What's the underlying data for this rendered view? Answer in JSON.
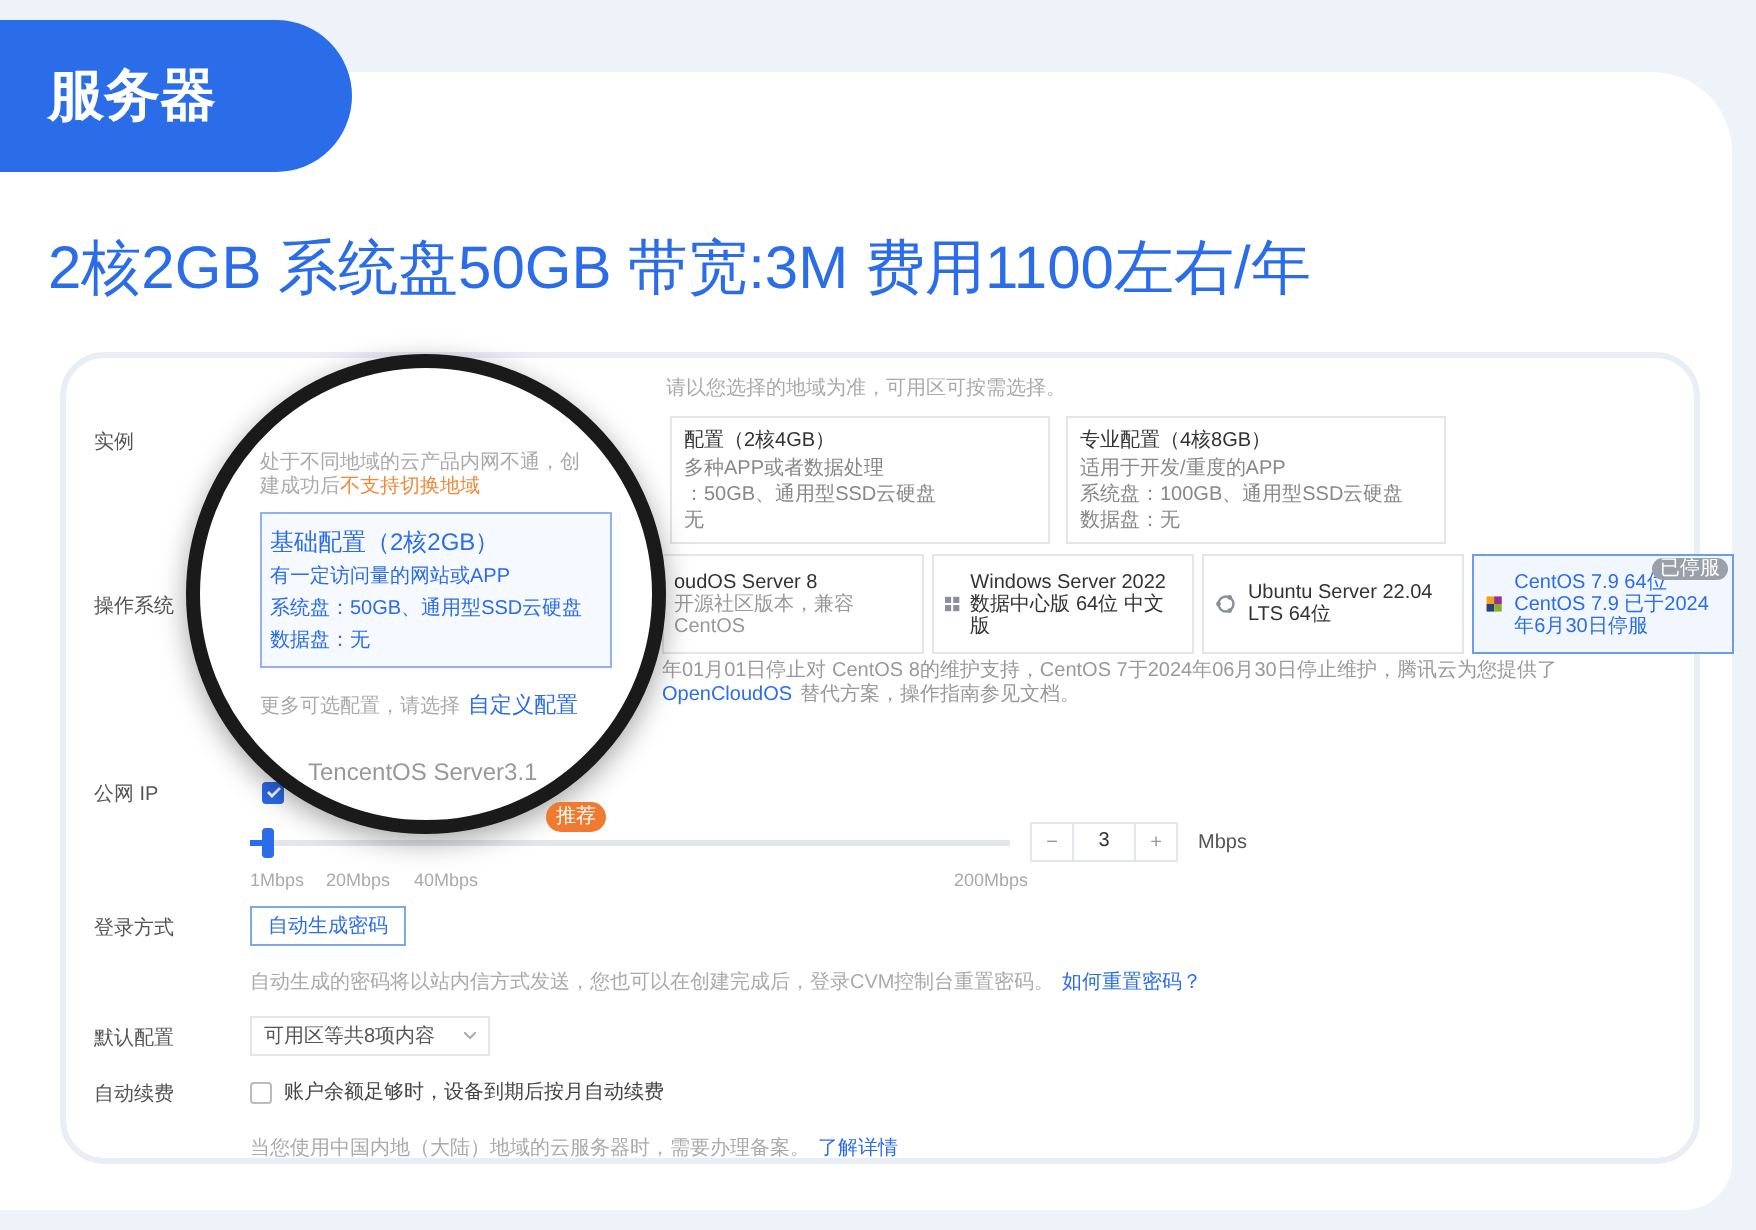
{
  "badge": "服务器",
  "headline": "2核2GB 系统盘50GB 带宽:3M 费用1100左右/年",
  "top_note": "请以您选择的地域为准，可用区可按需选择。",
  "instance": {
    "label": "实例",
    "cards": [
      {
        "title": "配置（2核4GB）",
        "lines": [
          "多种APP或者数据处理",
          "：50GB、通用型SSD云硬盘",
          "无"
        ]
      },
      {
        "title": "专业配置（4核8GB）",
        "lines": [
          "适用于开发/重度的APP",
          "系统盘：100GB、通用型SSD云硬盘",
          "数据盘：无"
        ]
      }
    ]
  },
  "os": {
    "label": "操作系统",
    "cards": [
      {
        "kind": "cloud",
        "title": "oudOS Server 8",
        "sub": "开源社区版本，兼容CentOS",
        "selected": false
      },
      {
        "kind": "windows",
        "title": "Windows Server 2022 数据中心版 64位 中文版",
        "selected": false
      },
      {
        "kind": "ubuntu",
        "title": "Ubuntu Server 22.04 LTS 64位",
        "selected": false
      },
      {
        "kind": "centos",
        "title": "CentOS 7.9 64位",
        "sub": "CentOS 7.9 已于2024年6月30日停服",
        "tag": "已停服",
        "selected": true
      }
    ],
    "note": "年01月01日停止对 CentOS 8的维护支持，CentOS 7于2024年06月30日停止维护，腾讯云为您提供了",
    "note_link": "OpenCloudOS",
    "note_tail": "替代方案，操作指南参见文档。"
  },
  "public_ip": {
    "label": "公网 IP",
    "checked": true,
    "level": 0.015,
    "ticks": [
      "1Mbps",
      "20Mbps",
      "40Mbps",
      "200Mbps"
    ],
    "minus": "−",
    "value": "3",
    "plus": "+",
    "unit": "Mbps"
  },
  "login": {
    "label": "登录方式",
    "button": "自动生成密码",
    "hint": "自动生成的密码将以站内信方式发送，您也可以在创建完成后，登录CVM控制台重置密码。",
    "hint_link": "如何重置密码？"
  },
  "defaults": {
    "label": "默认配置",
    "select": "可用区等共8项内容"
  },
  "renew": {
    "label": "自动续费",
    "checked": false,
    "text": "账户余额足够时，设备到期后按月自动续费",
    "hint": "当您使用中国内地（大陆）地域的云服务器时，需要办理备案。",
    "hint_link": "了解详情"
  },
  "lens": {
    "warning": "处于不同地域的云产品内网不通，创建成功后",
    "warning_em": "不支持切换地域",
    "card_title": "基础配置（2核2GB）",
    "card_lines": [
      "有一定访问量的网站或APP",
      "系统盘：50GB、通用型SSD云硬盘",
      "数据盘：无"
    ],
    "more": "更多可选配置，请选择",
    "more_link": "自定义配置",
    "os_name": "TencentOS Server3.1",
    "tag": "推荐"
  }
}
